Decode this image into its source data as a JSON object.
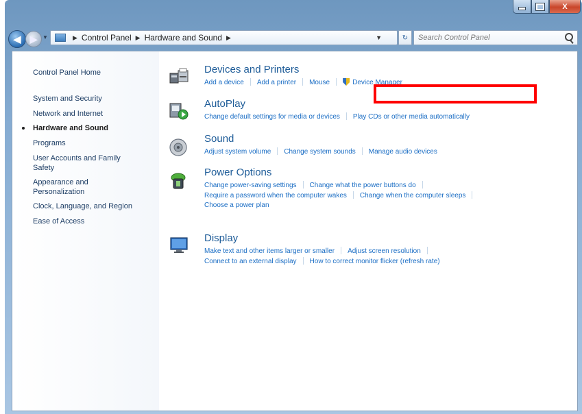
{
  "window": {
    "caption_icons": [
      "minimize-icon",
      "maximize-icon",
      "close-icon"
    ],
    "close_label": "X"
  },
  "nav": {
    "back_icon": "back-arrow-icon",
    "forward_icon": "forward-arrow-icon",
    "breadcrumbs": [
      "Control Panel",
      "Hardware and Sound"
    ],
    "search_placeholder": "Search Control Panel"
  },
  "sidebar": {
    "items": [
      {
        "label": "Control Panel Home"
      },
      {
        "label": "System and Security"
      },
      {
        "label": "Network and Internet"
      },
      {
        "label": "Hardware and Sound",
        "current": true
      },
      {
        "label": "Programs"
      },
      {
        "label": "User Accounts and Family Safety"
      },
      {
        "label": "Appearance and Personalization"
      },
      {
        "label": "Clock, Language, and Region"
      },
      {
        "label": "Ease of Access"
      }
    ]
  },
  "categories": [
    {
      "title": "Devices and Printers",
      "icon": "printer-icon",
      "links": [
        "Add a device",
        "Add a printer",
        "Mouse",
        "Device Manager"
      ]
    },
    {
      "title": "AutoPlay",
      "icon": "autoplay-icon",
      "links": [
        "Change default settings for media or devices",
        "Play CDs or other media automatically"
      ]
    },
    {
      "title": "Sound",
      "icon": "speaker-icon",
      "links": [
        "Adjust system volume",
        "Change system sounds",
        "Manage audio devices"
      ]
    },
    {
      "title": "Power Options",
      "icon": "power-options-icon",
      "links": [
        "Change power-saving settings",
        "Change what the power buttons do",
        "Require a password when the computer wakes",
        "Change when the computer sleeps",
        "Choose a power plan"
      ]
    },
    {
      "title": "Display",
      "icon": "display-icon",
      "links": [
        "Make text and other items larger or smaller",
        "Adjust screen resolution",
        "Connect to an external display",
        "How to correct monitor flicker (refresh rate)"
      ]
    }
  ],
  "annotation": {
    "highlight_color": "#ff0000",
    "target": "Device Manager"
  },
  "colors": {
    "link": "#1a6dc4",
    "title": "#1e5c98",
    "sidebar_link": "#1f3f66"
  }
}
